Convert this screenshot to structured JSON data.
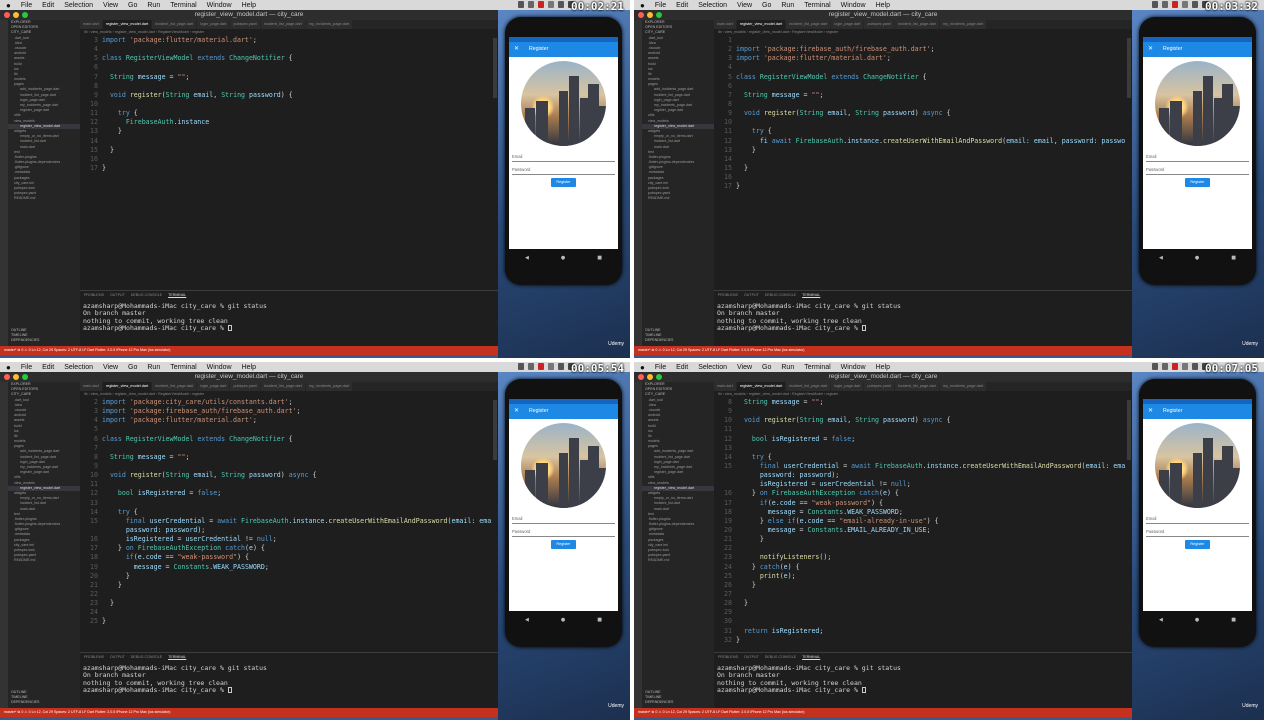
{
  "menubar": {
    "items": [
      "Code",
      "File",
      "Edit",
      "Selection",
      "View",
      "Go",
      "Run",
      "Terminal",
      "Window",
      "Help"
    ]
  },
  "window_title": "register_view_model.dart — city_care",
  "phone": {
    "appbar_title": "Register",
    "email_label": "Email",
    "password_label": "Password",
    "register_button": "Register"
  },
  "terminal_lines": [
    "azamsharp@Mohammads-iMac city_care % git status",
    "On branch master",
    "nothing to commit, working tree clean",
    "azamsharp@Mohammads-iMac city_care % "
  ],
  "panel_tabs": [
    "PROBLEMS",
    "OUTPUT",
    "DEBUG CONSOLE",
    "TERMINAL"
  ],
  "outline_items": [
    "OUTLINE",
    "TIMELINE",
    "DEPENDENCIES"
  ],
  "watermark": "Udemy",
  "colors": {
    "accent": "#1e88e5",
    "statusbar": "#c5311f",
    "editor_bg": "#1e1e1e"
  },
  "quadrants": [
    {
      "timestamp": "00:02:21",
      "code": [
        {
          "n": "3",
          "t": "import 'package:flutter/material.dart';"
        },
        {
          "n": "4",
          "t": ""
        },
        {
          "n": "5",
          "t": "class RegisterViewModel extends ChangeNotifier {"
        },
        {
          "n": "6",
          "t": ""
        },
        {
          "n": "7",
          "t": "  String message = \"\";"
        },
        {
          "n": "8",
          "t": ""
        },
        {
          "n": "9",
          "t": "  void register(String email, String password) {"
        },
        {
          "n": "10",
          "t": ""
        },
        {
          "n": "11",
          "t": "    try {"
        },
        {
          "n": "12",
          "t": "      FirebaseAuth.instance"
        },
        {
          "n": "13",
          "t": "    }"
        },
        {
          "n": "14",
          "t": ""
        },
        {
          "n": "15",
          "t": "  }"
        },
        {
          "n": "16",
          "t": ""
        },
        {
          "n": "17",
          "t": "}"
        }
      ]
    },
    {
      "timestamp": "00:03:32",
      "code": [
        {
          "n": "1",
          "t": ""
        },
        {
          "n": "2",
          "t": "import 'package:firebase_auth/firebase_auth.dart';"
        },
        {
          "n": "3",
          "t": "import 'package:flutter/material.dart';"
        },
        {
          "n": "4",
          "t": ""
        },
        {
          "n": "5",
          "t": "class RegisterViewModel extends ChangeNotifier {"
        },
        {
          "n": "6",
          "t": ""
        },
        {
          "n": "7",
          "t": "  String message = \"\";"
        },
        {
          "n": "8",
          "t": ""
        },
        {
          "n": "9",
          "t": "  void register(String email, String password) async {"
        },
        {
          "n": "10",
          "t": ""
        },
        {
          "n": "11",
          "t": "    try {"
        },
        {
          "n": "12",
          "t": "      fi await FirebaseAuth.instance.createUserWithEmailAndPassword(email: email, password: password);"
        },
        {
          "n": "13",
          "t": "    }"
        },
        {
          "n": "14",
          "t": ""
        },
        {
          "n": "15",
          "t": "  }"
        },
        {
          "n": "16",
          "t": ""
        },
        {
          "n": "17",
          "t": "}"
        }
      ]
    },
    {
      "timestamp": "00:05:54",
      "code": [
        {
          "n": "2",
          "t": "import 'package:city_care/utils/constants.dart';"
        },
        {
          "n": "3",
          "t": "import 'package:firebase_auth/firebase_auth.dart';"
        },
        {
          "n": "4",
          "t": "import 'package:flutter/material.dart';"
        },
        {
          "n": "5",
          "t": ""
        },
        {
          "n": "6",
          "t": "class RegisterViewModel extends ChangeNotifier {"
        },
        {
          "n": "7",
          "t": ""
        },
        {
          "n": "8",
          "t": "  String message = \"\";"
        },
        {
          "n": "9",
          "t": ""
        },
        {
          "n": "10",
          "t": "  void register(String email, String password) async {"
        },
        {
          "n": "11",
          "t": ""
        },
        {
          "n": "12",
          "t": "    bool isRegistered = false;"
        },
        {
          "n": "13",
          "t": ""
        },
        {
          "n": "14",
          "t": "    try {"
        },
        {
          "n": "15",
          "t": "      final userCredential = await FirebaseAuth.instance.createUserWithEmailAndPassword(email: email,"
        },
        {
          "n": "",
          "t": "      password: password);"
        },
        {
          "n": "16",
          "t": "      isRegistered = userCredential != null;"
        },
        {
          "n": "17",
          "t": "    } on FirebaseAuthException catch(e) {"
        },
        {
          "n": "18",
          "t": "      if(e.code == \"weak-password\") {"
        },
        {
          "n": "19",
          "t": "        message = Constants.WEAK_PASSWORD;"
        },
        {
          "n": "20",
          "t": "      }"
        },
        {
          "n": "21",
          "t": "    }"
        },
        {
          "n": "22",
          "t": ""
        },
        {
          "n": "23",
          "t": "  }"
        },
        {
          "n": "24",
          "t": ""
        },
        {
          "n": "25",
          "t": "}"
        }
      ]
    },
    {
      "timestamp": "00:07:05",
      "code": [
        {
          "n": "8",
          "t": "  String message = \"\";"
        },
        {
          "n": "9",
          "t": ""
        },
        {
          "n": "10",
          "t": "  void register(String email, String password) async {"
        },
        {
          "n": "11",
          "t": ""
        },
        {
          "n": "12",
          "t": "    bool isRegistered = false;"
        },
        {
          "n": "13",
          "t": ""
        },
        {
          "n": "14",
          "t": "    try {"
        },
        {
          "n": "15",
          "t": "      final userCredential = await FirebaseAuth.instance.createUserWithEmailAndPassword(email: email,"
        },
        {
          "n": "",
          "t": "      password: password);"
        },
        {
          "n": "",
          "t": "      isRegistered = userCredential != null;"
        },
        {
          "n": "16",
          "t": "    } on FirebaseAuthException catch(e) {"
        },
        {
          "n": "17",
          "t": "      if(e.code == \"weak-password\") {"
        },
        {
          "n": "18",
          "t": "        message = Constants.WEAK_PASSWORD;"
        },
        {
          "n": "19",
          "t": "      } else if(e.code == \"email-already-in-use\") {"
        },
        {
          "n": "20",
          "t": "        message = Constants.EMAIL_ALREADY_IN_USE;"
        },
        {
          "n": "21",
          "t": "      }"
        },
        {
          "n": "22",
          "t": ""
        },
        {
          "n": "23",
          "t": "      notifyListeners();"
        },
        {
          "n": "24",
          "t": "    } catch(e) {"
        },
        {
          "n": "25",
          "t": "      print(e);"
        },
        {
          "n": "26",
          "t": "    }"
        },
        {
          "n": "27",
          "t": ""
        },
        {
          "n": "28",
          "t": "  }"
        },
        {
          "n": "29",
          "t": ""
        },
        {
          "n": "30",
          "t": ""
        },
        {
          "n": "31",
          "t": "  return isRegistered;"
        },
        {
          "n": "32",
          "t": "}"
        }
      ]
    }
  ]
}
